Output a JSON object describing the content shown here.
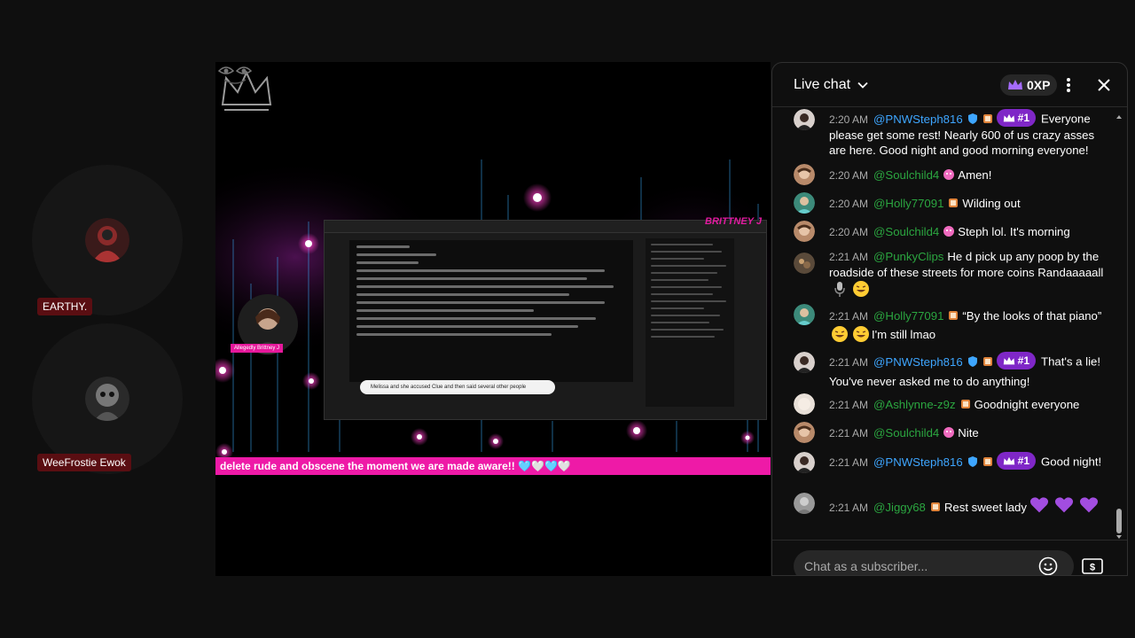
{
  "participants": [
    {
      "name": "EARTHY."
    },
    {
      "name": "WeeFrostie Ewok"
    }
  ],
  "video": {
    "host_label": "Allegedly Brittney J",
    "brand_name": "BRITTNEY J",
    "ticker_text": "delete rude and obscene the moment we are made aware!! 🩵🤍🩵🤍",
    "caption_text": "Melissa and she accused Clue and then said several other people"
  },
  "chat": {
    "title": "Live chat",
    "xp_label": "0XP",
    "input_placeholder": "Chat as a subscriber...",
    "messages": [
      {
        "time": "2:20 AM",
        "author": "@PNWSteph816",
        "rank": "#1",
        "text": "Everyone please get some rest! Nearly 600 of us crazy asses are here. Good night and good morning everyone!"
      },
      {
        "time": "2:20 AM",
        "author": "@Soulchild4",
        "text": "Amen!"
      },
      {
        "time": "2:20 AM",
        "author": "@Holly77091",
        "text": "Wilding out"
      },
      {
        "time": "2:20 AM",
        "author": "@Soulchild4",
        "text": "Steph lol. It's morning"
      },
      {
        "time": "2:21 AM",
        "author": "@PunkyClips",
        "text": "He d pick up any poop by the roadside of these streets for more coins Randaaaaall"
      },
      {
        "time": "2:21 AM",
        "author": "@Holly77091",
        "text_a": "“By the looks of that piano”",
        "text_b": "I'm still lmao"
      },
      {
        "time": "2:21 AM",
        "author": "@PNWSteph816",
        "rank": "#1",
        "text": "That's a lie! You've never asked me to do anything!"
      },
      {
        "time": "2:21 AM",
        "author": "@Ashlynne-z9z",
        "text": "Goodnight everyone"
      },
      {
        "time": "2:21 AM",
        "author": "@Soulchild4",
        "text": "Nite"
      },
      {
        "time": "2:21 AM",
        "author": "@PNWSteph816",
        "rank": "#1",
        "text": "Good night!"
      },
      {
        "time": "2:21 AM",
        "author": "@Jiggy68",
        "text": "Rest sweet lady"
      }
    ]
  },
  "colors": {
    "accent_pink": "#ee1aa7",
    "member_blue": "#3ea6ff",
    "author_green": "#2ba640",
    "rank_purple": "#7f27c7"
  },
  "icons": [
    "chevron-down-icon",
    "crown-icon",
    "more-vert-icon",
    "close-icon",
    "verified-shield-icon",
    "member-badge-icon",
    "emoji-icon",
    "super-chat-icon"
  ]
}
